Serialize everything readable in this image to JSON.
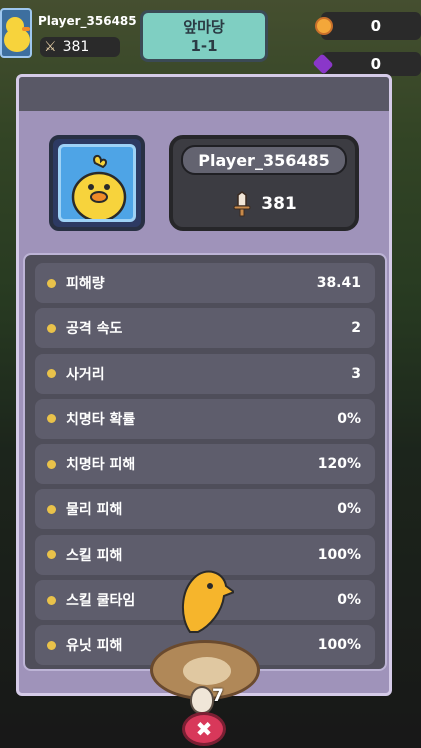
{
  "hud": {
    "player_name": "Player_356485",
    "power": "381",
    "stage_title": "앞마당",
    "stage_number": "1-1",
    "coins": "0",
    "gems": "0"
  },
  "profile": {
    "name": "Player_356485",
    "power": "381"
  },
  "stats": [
    {
      "label": "피해량",
      "value": "38.41"
    },
    {
      "label": "공격 속도",
      "value": "2"
    },
    {
      "label": "사거리",
      "value": "3"
    },
    {
      "label": "치명타 확률",
      "value": "0%"
    },
    {
      "label": "치명타 피해",
      "value": "120%"
    },
    {
      "label": "물리 피해",
      "value": "0%"
    },
    {
      "label": "스킬 피해",
      "value": "100%"
    },
    {
      "label": "스킬 쿨타임",
      "value": "0%"
    },
    {
      "label": "유닛 피해",
      "value": "100%"
    }
  ],
  "bottom": {
    "egg_count": "7",
    "close_symbol": "✖"
  },
  "colors": {
    "modal_bg": "#9f93ba",
    "stat_row_bg": "#5e5d6c",
    "dot": "#e9c24a",
    "close_button": "#d8385a"
  }
}
